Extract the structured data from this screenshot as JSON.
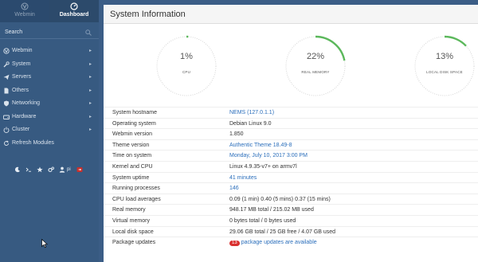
{
  "sidebar": {
    "tabs": [
      {
        "label": "Webmin",
        "icon": "webmin-logo-icon"
      },
      {
        "label": "Dashboard",
        "icon": "dashboard-icon"
      }
    ],
    "search": {
      "label": "Search"
    },
    "items": [
      {
        "label": "Webmin",
        "icon": "webmin-logo-icon",
        "chevron": "▸"
      },
      {
        "label": "System",
        "icon": "wrench-icon",
        "chevron": "▸"
      },
      {
        "label": "Servers",
        "icon": "paper-plane-icon",
        "chevron": "▸"
      },
      {
        "label": "Others",
        "icon": "file-icon",
        "chevron": "▸"
      },
      {
        "label": "Networking",
        "icon": "shield-icon",
        "chevron": "▸"
      },
      {
        "label": "Hardware",
        "icon": "hdd-icon",
        "chevron": "▸"
      },
      {
        "label": "Cluster",
        "icon": "power-icon",
        "chevron": "▸"
      },
      {
        "label": "Refresh Modules",
        "icon": "refresh-icon",
        "chevron": ""
      }
    ],
    "toolbar": [
      {
        "icon": "moon-icon"
      },
      {
        "icon": "terminal-icon"
      },
      {
        "icon": "star-icon"
      },
      {
        "icon": "cogs-icon"
      },
      {
        "icon": "user-icon",
        "text": "pi"
      },
      {
        "icon": "logout-icon"
      }
    ]
  },
  "main": {
    "title": "System Information",
    "accent_color": "#5cb85c",
    "gauges": [
      {
        "value": "1",
        "unit": "%",
        "label": "CPU",
        "percent": 1
      },
      {
        "value": "22",
        "unit": "%",
        "label": "REAL MEMORY",
        "percent": 22
      },
      {
        "value": "13",
        "unit": "%",
        "label": "LOCAL DISK SPACE",
        "percent": 13
      }
    ],
    "info": [
      {
        "key": "System hostname",
        "value": "NEMS (127.0.1.1)",
        "link": true
      },
      {
        "key": "Operating system",
        "value": "Debian Linux 9.0",
        "link": false
      },
      {
        "key": "Webmin version",
        "value": "1.850",
        "link": false
      },
      {
        "key": "Theme version",
        "value": "Authentic Theme 18.49-8",
        "link": true
      },
      {
        "key": "Time on system",
        "value": "Monday, July 10, 2017 3:00 PM",
        "link": true
      },
      {
        "key": "Kernel and CPU",
        "value": "Linux 4.9.35-v7+ on armv7l",
        "link": false
      },
      {
        "key": "System uptime",
        "value": "41 minutes",
        "link": true
      },
      {
        "key": "Running processes",
        "value": "146",
        "link": true
      },
      {
        "key": "CPU load averages",
        "value": "0.09 (1 min) 0.40 (5 mins) 0.37 (15 mins)",
        "link": false
      },
      {
        "key": "Real memory",
        "value": "948.17 MB total / 215.02 MB used",
        "link": false
      },
      {
        "key": "Virtual memory",
        "value": "0 bytes total / 0 bytes used",
        "link": false
      },
      {
        "key": "Local disk space",
        "value": "29.06 GB total / 25 GB free / 4.07 GB used",
        "link": false
      },
      {
        "key": "Package updates",
        "badge": "13",
        "value": "package updates are available",
        "link": true
      }
    ]
  }
}
